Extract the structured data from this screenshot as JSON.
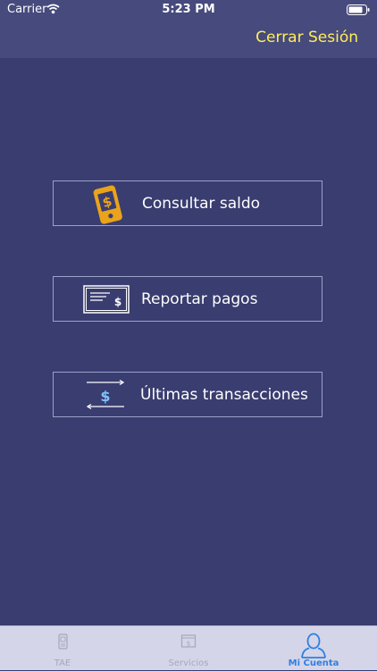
{
  "status_bar": {
    "carrier": "Carrier",
    "time": "5:23 PM"
  },
  "nav": {
    "logout_label": "Cerrar Sesión"
  },
  "menu": {
    "items": [
      {
        "label": "Consultar saldo",
        "icon": "phone-dollar-icon"
      },
      {
        "label": "Reportar pagos",
        "icon": "receipt-dollar-icon"
      },
      {
        "label": "Últimas transacciones",
        "icon": "transfer-dollar-icon"
      }
    ]
  },
  "tabs": [
    {
      "label": "TAE",
      "icon": "phone-icon",
      "active": false
    },
    {
      "label": "Servicios",
      "icon": "bill-icon",
      "active": false
    },
    {
      "label": "Mi Cuenta",
      "icon": "user-icon",
      "active": true
    }
  ],
  "colors": {
    "background": "#3a3d70",
    "nav_background": "#474a7d",
    "logout": "#ffee55",
    "icon_gold": "#e9a31c",
    "tab_active": "#2f7fe0"
  }
}
